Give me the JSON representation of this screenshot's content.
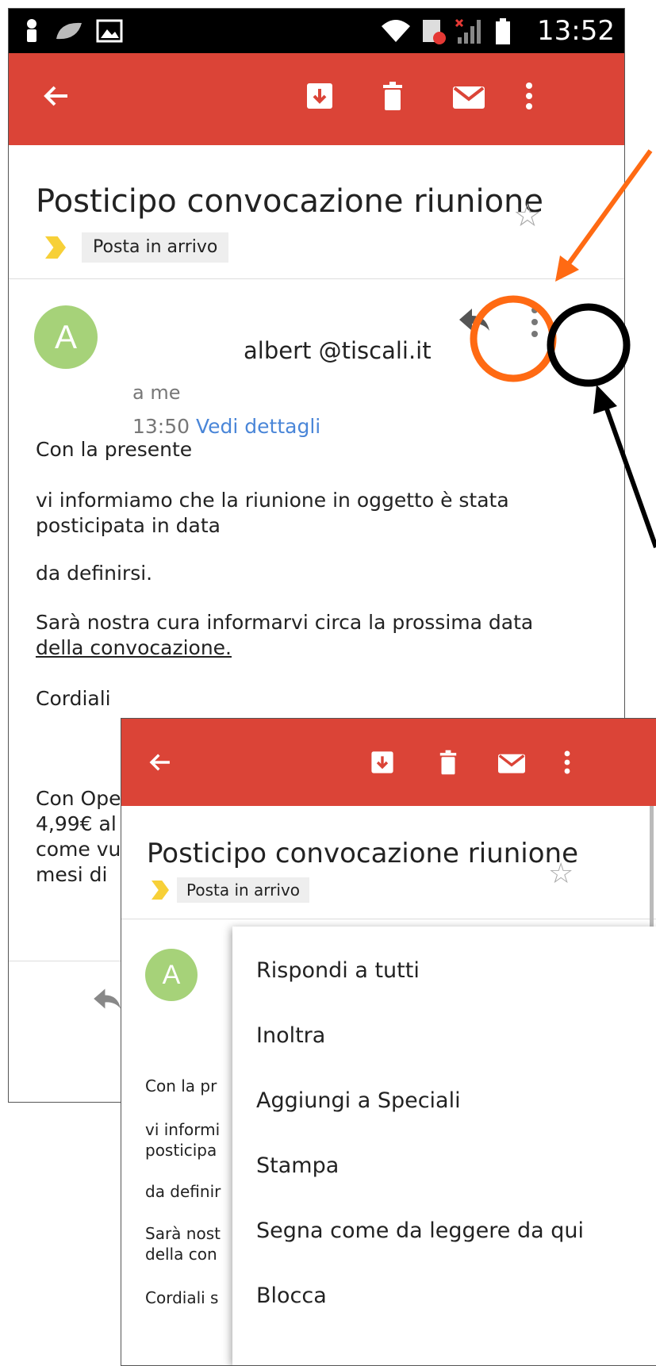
{
  "status_bar": {
    "time": "13:52"
  },
  "email": {
    "subject": "Posticipo convocazione riunione",
    "label": "Posta in arrivo",
    "sender": "albert @tiscali.it",
    "avatar_letter": "A",
    "recipient": "a me",
    "time": "13:50",
    "details_link": "Vedi dettagli",
    "body": [
      "Con la presente",
      "vi informiamo che la riunione in oggetto è stata",
      "posticipata in data",
      "da definirsi.",
      "Sarà nostra cura informarvi circa la prossima data",
      "della convocazione.",
      "Cordiali",
      "Con Ope",
      "4,99€ al",
      "come vu",
      "mesi di"
    ]
  },
  "second_view": {
    "subject": "Posticipo convocazione riunione",
    "label": "Posta in arrivo",
    "avatar_letter": "A",
    "body_partial": [
      "Con la pr",
      "vi informi",
      "posticipa",
      "da definir",
      "Sarà nost",
      "della con",
      "Cordiali s"
    ]
  },
  "overflow_menu": {
    "items": [
      "Rispondi a tutti",
      "Inoltra",
      "Aggiungi a Speciali",
      "Stampa",
      "Segna come da leggere da qui",
      "Blocca"
    ]
  },
  "colors": {
    "app_bar": "#db4437",
    "avatar": "#a6d279",
    "link": "#4a86d8",
    "highlight_orange": "#ff6a13",
    "highlight_black": "#000000"
  },
  "icons": {
    "app_bar": [
      "back-arrow-icon",
      "archive-icon",
      "delete-icon",
      "mark-unread-icon",
      "more-vert-icon"
    ],
    "message": [
      "reply-icon",
      "more-vert-icon",
      "star-icon",
      "label-chevron-icon"
    ]
  }
}
